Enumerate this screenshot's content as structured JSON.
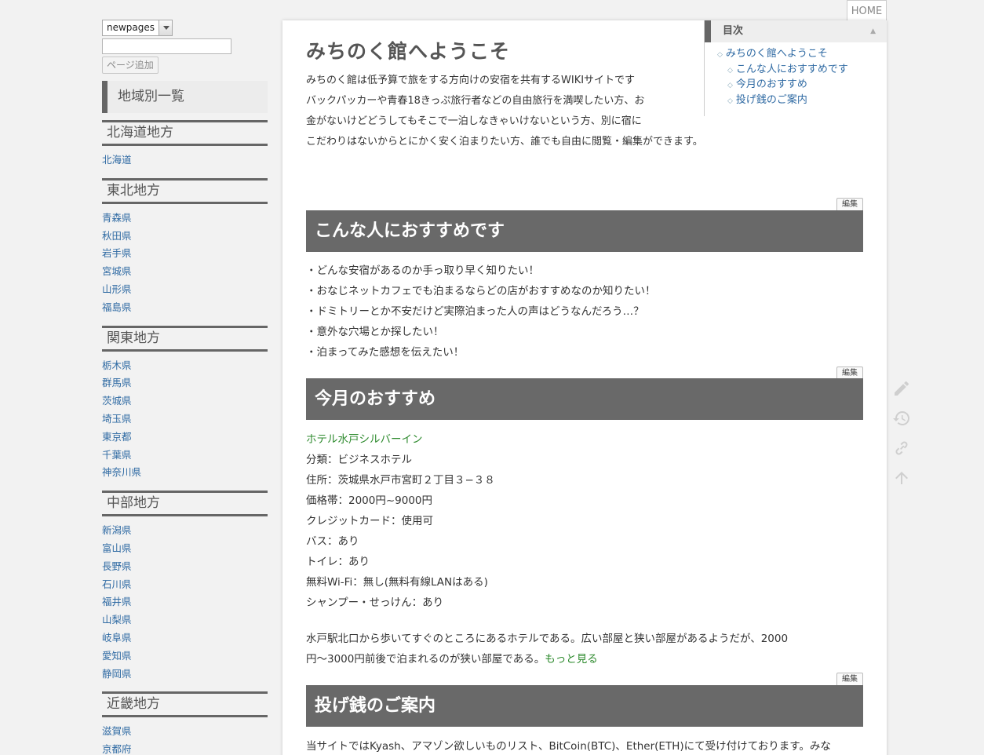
{
  "sidebar": {
    "page_select_value": "newpages",
    "add_page_label": "ページ追加",
    "regions_all_title": "地域別一覧",
    "regions": [
      {
        "name": "北海道地方",
        "items": [
          "北海道"
        ]
      },
      {
        "name": "東北地方",
        "items": [
          "青森県",
          "秋田県",
          "岩手県",
          "宮城県",
          "山形県",
          "福島県"
        ]
      },
      {
        "name": "関東地方",
        "items": [
          "栃木県",
          "群馬県",
          "茨城県",
          "埼玉県",
          "東京都",
          "千葉県",
          "神奈川県"
        ]
      },
      {
        "name": "中部地方",
        "items": [
          "新潟県",
          "富山県",
          "長野県",
          "石川県",
          "福井県",
          "山梨県",
          "岐阜県",
          "愛知県",
          "静岡県"
        ]
      },
      {
        "name": "近畿地方",
        "items": [
          "滋賀県",
          "京都府"
        ]
      }
    ]
  },
  "header": {
    "home_label": "HOME"
  },
  "main": {
    "title": "みちのく館へようこそ",
    "intro_lines": [
      "みちのく館は低予算で旅をする方向けの安宿を共有するWIKIサイトです",
      "バックパッカーや青春18きっぷ旅行者などの自由旅行を満喫したい方、お",
      "金がないけどどうしてもそこで一泊しなきゃいけないという方、別に宿に",
      "こだわりはないからとにかく安く泊まりたい方、誰でも自由に閲覧・編集ができます。"
    ],
    "toc": {
      "title": "目次",
      "collapse_symbol": "▲",
      "items": [
        {
          "label": "みちのく館へようこそ",
          "level": 1
        },
        {
          "label": "こんな人におすすめです",
          "level": 2
        },
        {
          "label": "今月のおすすめ",
          "level": 2
        },
        {
          "label": "投げ銭のご案内",
          "level": 2
        }
      ]
    },
    "edit_label": "編集",
    "section1": {
      "title": "こんな人におすすめです",
      "bullets": [
        "・どんな安宿があるのか手っ取り早く知りたい！",
        "・おなじネットカフェでも泊まるならどの店がおすすめなのか知りたい！",
        "・ドミトリーとか不安だけど実際泊まった人の声はどうなんだろう…？",
        "・意外な穴場とか探したい！",
        "・泊まってみた感想を伝えたい！"
      ]
    },
    "section2": {
      "title": "今月のおすすめ",
      "hotel_link": "ホテル水戸シルバーイン",
      "details": [
        "分類：ビジネスホテル",
        "住所：茨城県水戸市宮町２丁目３−３８",
        "価格帯：2000円~9000円",
        "クレジットカード：使用可",
        "バス：あり",
        "トイレ：あり",
        "無料Wi-Fi：無し(無料有線LANはある)",
        "シャンプー・せっけん：あり"
      ],
      "description_line1": "水戸駅北口から歩いてすぐのところにあるホテルである。広い部屋と狭い部屋があるようだが、2000",
      "description_line2": "円～3000円前後で泊まれるのが狭い部屋である。",
      "more_link": "もっと見る"
    },
    "section3": {
      "title": "投げ銭のご案内",
      "text": "当サイトではKyash、アマゾン欲しいものリスト、BitCoin(BTC)、Ether(ETH)にて受け付けております。みな"
    }
  },
  "side_icons": [
    "edit-pencil-icon",
    "history-icon",
    "link-icon",
    "scroll-top-arrow-icon"
  ]
}
